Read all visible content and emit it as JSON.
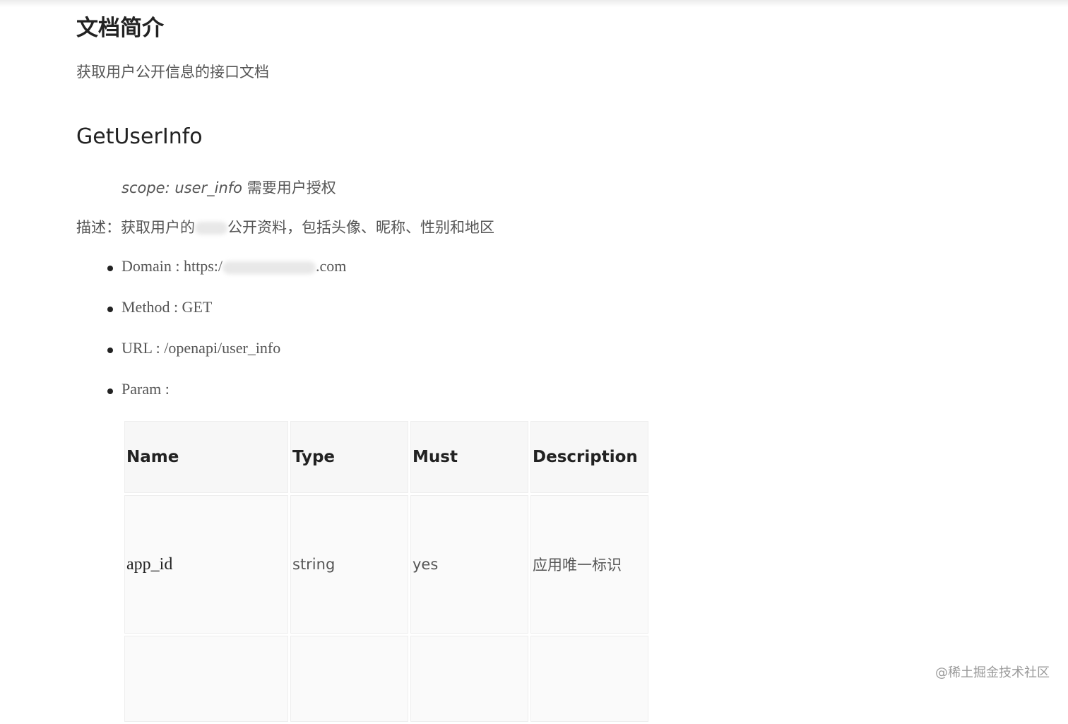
{
  "doc": {
    "title": "文档简介",
    "description": "获取用户公开信息的接口文档"
  },
  "api": {
    "title": "GetUserInfo",
    "scope_italic": "scope: user_info",
    "scope_text": " 需要用户授权",
    "describe_prefix": "描述：获取用户的",
    "describe_suffix": "公开资料，包括头像、昵称、性别和地区",
    "domain_prefix": "Domain : https:/",
    "domain_suffix": ".com",
    "method": "Method : GET",
    "url": "URL : /openapi/user_info",
    "param": "Param :"
  },
  "table": {
    "headers": [
      "Name",
      "Type",
      "Must",
      "Description"
    ],
    "rows": [
      [
        "app_id",
        "string",
        "yes",
        "应用唯一标识"
      ],
      [
        "",
        "",
        "",
        ""
      ]
    ]
  },
  "watermark": "@稀土掘金技术社区"
}
